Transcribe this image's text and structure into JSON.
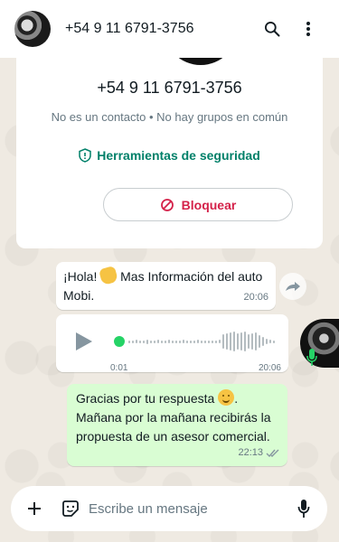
{
  "header": {
    "title": "+54 9 11 6791-3756",
    "icons": [
      "avatar",
      "search-icon",
      "more-vert-icon"
    ]
  },
  "card": {
    "phone": "+54 9 11 6791-3756",
    "subtitle": "No es un contacto • No hay grupos en común",
    "safety_tools": "Herramientas de seguridad",
    "block": "Bloquear",
    "accent_green": "#008069",
    "block_red": "#d4224a"
  },
  "messages": [
    {
      "text": "¡Hola! 👋 Mas Información del auto Mobi.",
      "time": "20:06",
      "direction": "incoming"
    },
    {
      "type": "voice",
      "duration": "0:01",
      "time": "20:06",
      "direction": "incoming"
    },
    {
      "text": "Gracias por tu respuesta 😊. Mañana por la mañana recibirás la propuesta de un asesor comercial.",
      "time": "22:13",
      "direction": "outgoing",
      "status": "read"
    }
  ],
  "msg1": {
    "pre": "¡Hola!",
    "post": "Mas Información del auto Mobi."
  },
  "msg3": {
    "pre": "Gracias por tu respuesta",
    "post": ". Mañana por la mañana recibirás la propuesta de un asesor comercial."
  },
  "composer": {
    "placeholder": "Escribe un mensaje"
  }
}
